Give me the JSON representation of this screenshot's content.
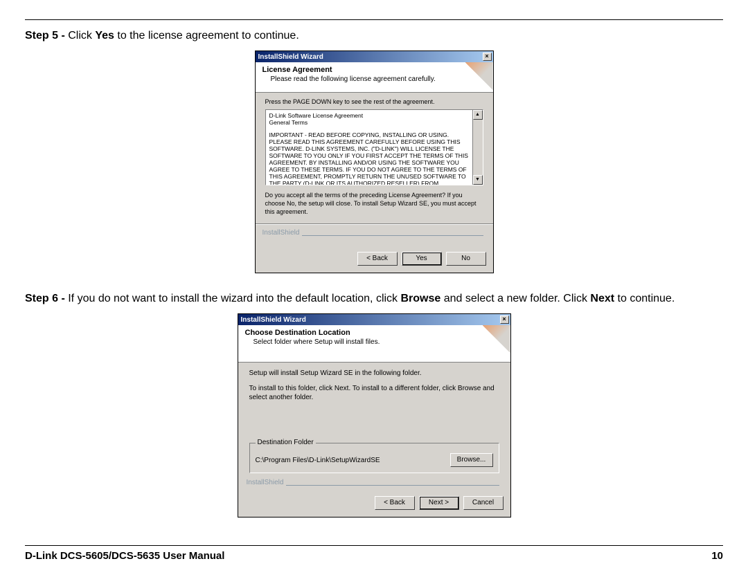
{
  "step5": {
    "label": "Step 5 - ",
    "pre": "Click ",
    "bold": "Yes",
    "post": " to the license agreement to continue."
  },
  "step6": {
    "label": "Step 6 - ",
    "pre": "If you do not want to install the wizard into the default location, click ",
    "bold1": "Browse",
    "mid": " and select a new folder. Click ",
    "bold2": "Next",
    "post": " to continue."
  },
  "win1": {
    "title": "InstallShield Wizard",
    "banner_title": "License Agreement",
    "banner_sub": "Please read the following license agreement carefully.",
    "instr": "Press the PAGE DOWN key to see the rest of the agreement.",
    "eula_l1": "D-Link Software License Agreement",
    "eula_l2": "General Terms",
    "eula_body": "IMPORTANT - READ BEFORE COPYING, INSTALLING OR USING.\nPLEASE READ THIS AGREEMENT CAREFULLY BEFORE USING THIS SOFTWARE. D-LINK SYSTEMS, INC. (\"D-LINK\") WILL LICENSE THE SOFTWARE TO YOU ONLY IF YOU FIRST ACCEPT THE TERMS OF THIS AGREEMENT. BY INSTALLING AND/OR USING THE SOFTWARE YOU AGREE TO THESE TERMS. IF YOU DO NOT AGREE TO THE TERMS OF THIS AGREEMENT, PROMPTLY RETURN THE UNUSED SOFTWARE TO THE PARTY (D-LINK OR ITS AUTHORIZED RESELLER) FROM",
    "accept_q": "Do you accept all the terms of the preceding License Agreement? If you choose No, the setup will close. To install Setup Wizard SE, you must accept this agreement.",
    "brand": "InstallShield",
    "btn_back": "< Back",
    "btn_yes": "Yes",
    "btn_no": "No"
  },
  "win2": {
    "title": "InstallShield Wizard",
    "banner_title": "Choose Destination Location",
    "banner_sub": "Select folder where Setup will install files.",
    "body_l1": "Setup will install Setup Wizard SE in the following folder.",
    "body_l2": "To install to this folder, click Next. To install to a different folder, click Browse and select another folder.",
    "group_legend": "Destination Folder",
    "path": "C:\\Program Files\\D-Link\\SetupWizardSE",
    "btn_browse": "Browse...",
    "brand": "InstallShield",
    "btn_back": "< Back",
    "btn_next": "Next >",
    "btn_cancel": "Cancel"
  },
  "footer": {
    "manual": "D-Link DCS-5605/DCS-5635 User Manual",
    "page": "10"
  }
}
